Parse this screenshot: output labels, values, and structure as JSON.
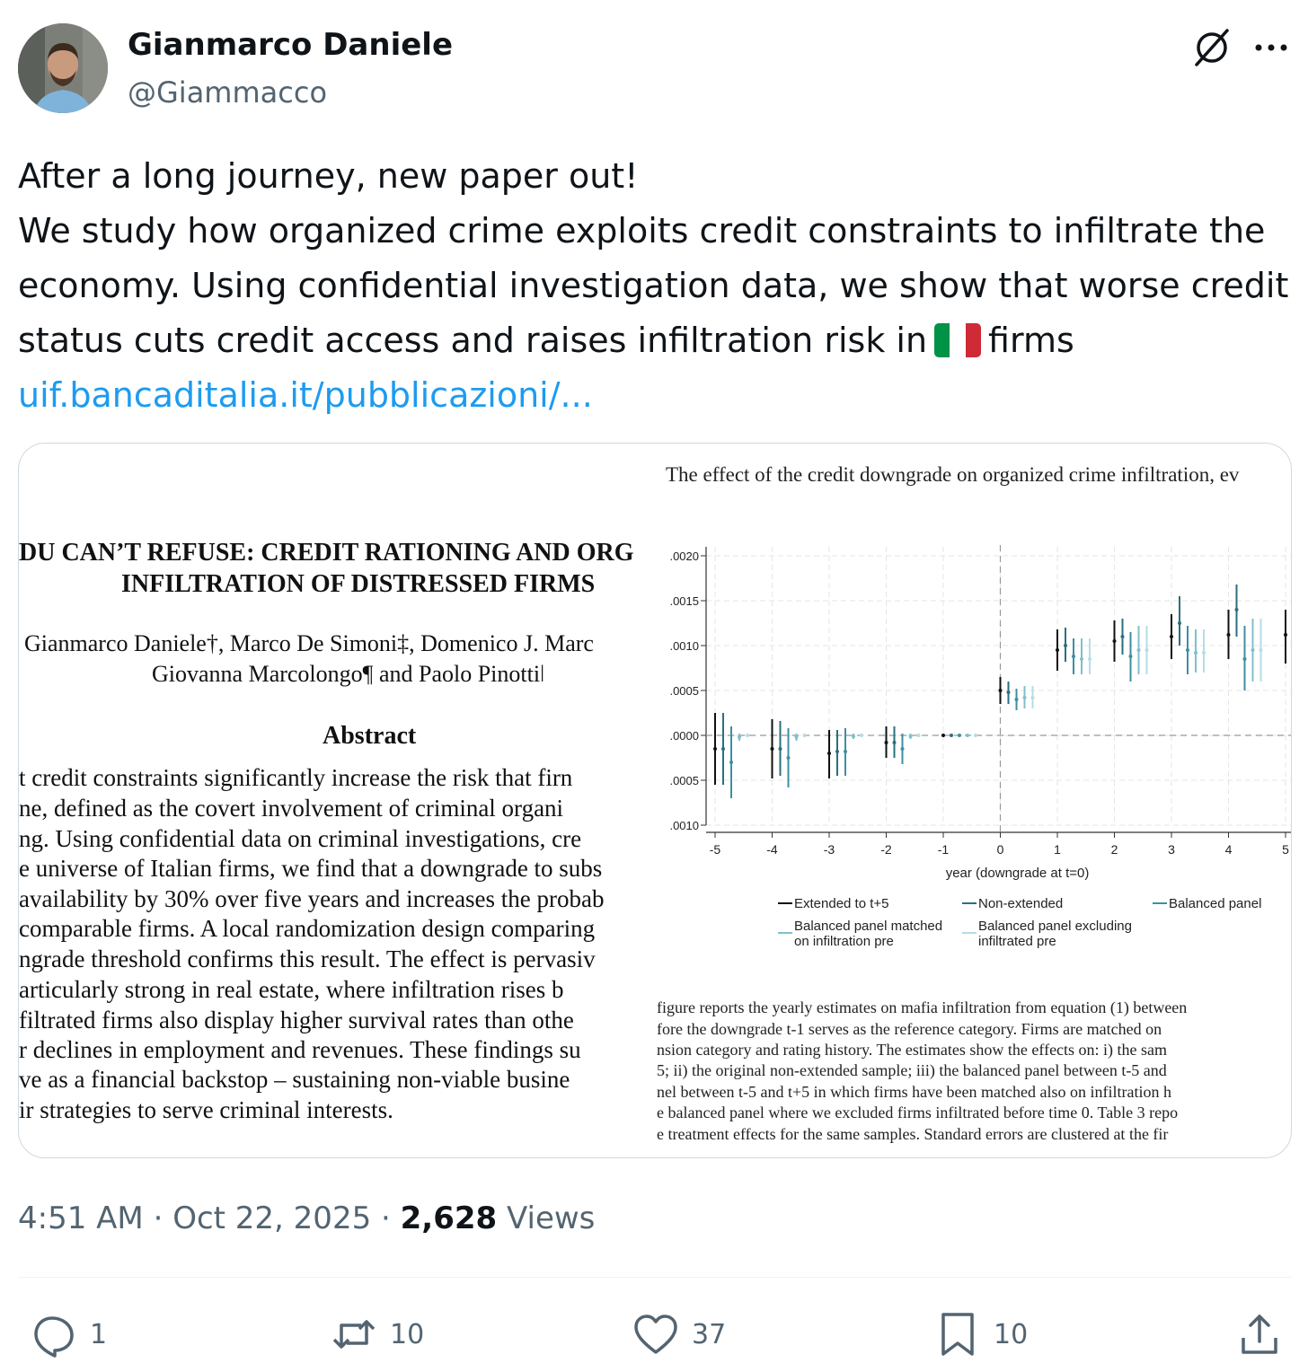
{
  "author": {
    "display_name": "Gianmarco Daniele",
    "handle": "@Giammacco"
  },
  "tweet": {
    "lines": [
      "After a long journey, new paper out!",
      "We study how organized crime exploits credit constraints to infiltrate the",
      "economy. Using confidential investigation data, we show that worse credit"
    ],
    "line4_before_flag": "status cuts credit access and raises infiltration risk in",
    "line4_after_flag": "firms",
    "link": "uif.bancaditalia.it/pubblicazioni/..."
  },
  "paper": {
    "title_lines": [
      "DU CAN’T REFUSE: CREDIT RATIONING AND ORG",
      "INFILTRATION OF DISTRESSED FIRMS"
    ],
    "authors_line1": "Gianmarco Daniele†, Marco De Simoni‡, Domenico J. Marc",
    "authors_line2": "Giovanna Marcolongo¶ and Paolo Pinottiǀ",
    "abstract_heading": "Abstract",
    "abstract_lines": [
      "t credit constraints significantly increase the risk that firn",
      "ne, defined as the covert involvement of criminal organi",
      "ng. Using confidential data on criminal investigations, cre",
      "e universe of Italian firms, we find that a downgrade to subs",
      "availability by 30% over five years and increases the probab",
      "comparable firms. A local randomization design comparing",
      "ngrade threshold confirms this result. The effect is pervasiv",
      "articularly strong in real estate, where infiltration rises b",
      "filtrated firms also display higher survival rates than othe",
      "r declines in employment and revenues. These findings su",
      "ve as a financial backstop – sustaining non-viable busine",
      "ir strategies to serve criminal interests."
    ]
  },
  "figure": {
    "title": "The effect of the credit downgrade on organized crime infiltration, ev",
    "caption_lines": [
      "figure reports the yearly estimates on mafia infiltration from equation (1) between",
      "fore the downgrade t-1 serves as the reference category.  Firms are matched on",
      "nsion category and rating history.  The estimates show the effects on: i) the sam",
      "5; ii) the original non-extended sample; iii) the balanced panel between t-5 and",
      "nel between t-5 and t+5 in which firms have been matched also on infiltration h",
      "e balanced panel where we excluded firms infiltrated before time 0.  Table 3 repo",
      "e treatment effects for the same samples. Standard errors are clustered at the fir"
    ]
  },
  "chart_data": {
    "type": "scatter",
    "xlabel": "year (downgrade at t=0)",
    "ylabel": "",
    "xlim": [
      -5,
      5
    ],
    "ylim": [
      -0.001,
      0.002
    ],
    "x_ticks": [
      "-5",
      "-4",
      "-3",
      "-2",
      "-1",
      "0",
      "1",
      "2",
      "3",
      "4",
      "5"
    ],
    "y_ticks": [
      ".0020",
      ".0015",
      ".0010",
      ".0005",
      ".0000",
      ".0005",
      ".0010"
    ],
    "y_tick_values": [
      0.002,
      0.0015,
      0.001,
      0.0005,
      0,
      -0.0005,
      -0.001
    ],
    "grid": true,
    "reference_lines": {
      "x": 0,
      "y": 0
    },
    "legend_position": "bottom",
    "series": [
      {
        "name": "Extended to t+5",
        "color": "#111111",
        "x": [
          -5,
          -4,
          -3,
          -2,
          -1,
          0,
          1,
          2,
          3,
          4,
          5
        ],
        "y": [
          -0.00015,
          -0.00015,
          -0.0002,
          -8e-05,
          0,
          0.0005,
          0.00095,
          0.00105,
          0.0011,
          0.00112,
          0.00112
        ],
        "ci_low": [
          -0.00055,
          -0.00048,
          -0.00048,
          -0.00025,
          0,
          0.00035,
          0.00072,
          0.00082,
          0.00085,
          0.00085,
          0.0008
        ],
        "ci_high": [
          0.00025,
          0.00018,
          6e-05,
          0.0001,
          0,
          0.00065,
          0.00118,
          0.00128,
          0.00135,
          0.0014,
          0.0014
        ]
      },
      {
        "name": "Non-extended",
        "color": "#2a6f7f",
        "x": [
          -5,
          -4,
          -3,
          -2,
          -1,
          0,
          1,
          2,
          3,
          4
        ],
        "y": [
          -0.00015,
          -0.00015,
          -0.00018,
          -8e-05,
          0,
          0.00048,
          0.001,
          0.0011,
          0.00125,
          0.0014
        ],
        "ci_low": [
          -0.00055,
          -0.00045,
          -0.00045,
          -0.00025,
          0,
          0.00035,
          0.00082,
          0.0009,
          0.001,
          0.0011
        ],
        "ci_high": [
          0.00025,
          0.00016,
          6e-05,
          0.0001,
          0,
          0.0006,
          0.0012,
          0.0013,
          0.00155,
          0.00168
        ]
      },
      {
        "name": "Balanced panel",
        "color": "#3d8fa1",
        "x": [
          -5,
          -4,
          -3,
          -2,
          -1,
          0,
          1,
          2,
          3,
          4
        ],
        "y": [
          -0.0003,
          -0.00025,
          -0.00018,
          -0.00015,
          0,
          0.0004,
          0.00088,
          0.00088,
          0.00095,
          0.00085
        ],
        "ci_low": [
          -0.0007,
          -0.00058,
          -0.00045,
          -0.00032,
          0,
          0.00028,
          0.00068,
          0.0006,
          0.00068,
          0.0005
        ],
        "ci_high": [
          0.0001,
          8e-05,
          8e-05,
          2e-05,
          0,
          0.00052,
          0.00108,
          0.00115,
          0.00122,
          0.00122
        ]
      },
      {
        "name": "Balanced panel matched on infiltration pre",
        "color": "#7fc0cc",
        "x": [
          -5,
          -4,
          -3,
          -2,
          -1,
          0,
          1,
          2,
          3,
          4
        ],
        "y": [
          -2e-05,
          -2e-05,
          -1e-05,
          -1e-05,
          0,
          0.00042,
          0.00085,
          0.00095,
          0.00092,
          0.00095
        ],
        "ci_low": [
          -6e-05,
          -6e-05,
          -4e-05,
          -4e-05,
          0,
          0.0003,
          0.00068,
          0.00068,
          0.0007,
          0.0006
        ],
        "ci_high": [
          2e-05,
          2e-05,
          2e-05,
          2e-05,
          0,
          0.00055,
          0.00108,
          0.00122,
          0.00118,
          0.0013
        ]
      },
      {
        "name": "Balanced panel excluding infiltrated pre",
        "color": "#b5dde4",
        "x": [
          -5,
          -4,
          -3,
          -2,
          -1,
          0,
          1,
          2,
          3,
          4
        ],
        "y": [
          0,
          0,
          0,
          0,
          0,
          0.00042,
          0.00085,
          0.00095,
          0.00092,
          0.00095
        ],
        "ci_low": [
          -2e-05,
          -2e-05,
          -2e-05,
          -2e-05,
          0,
          0.0003,
          0.00068,
          0.00068,
          0.0007,
          0.0006
        ],
        "ci_high": [
          2e-05,
          2e-05,
          2e-05,
          2e-05,
          0,
          0.00055,
          0.00108,
          0.00122,
          0.00118,
          0.0013
        ]
      }
    ]
  },
  "meta": {
    "time": "4:51 AM",
    "date": "Oct 22, 2025",
    "separator": "·",
    "views_count": "2,628",
    "views_label": "Views"
  },
  "actions": {
    "replies": "1",
    "reposts": "10",
    "likes": "37",
    "bookmarks": "10"
  },
  "icons": [
    "grok-icon",
    "more-icon",
    "reply-icon",
    "repost-icon",
    "like-icon",
    "bookmark-icon",
    "share-icon"
  ]
}
